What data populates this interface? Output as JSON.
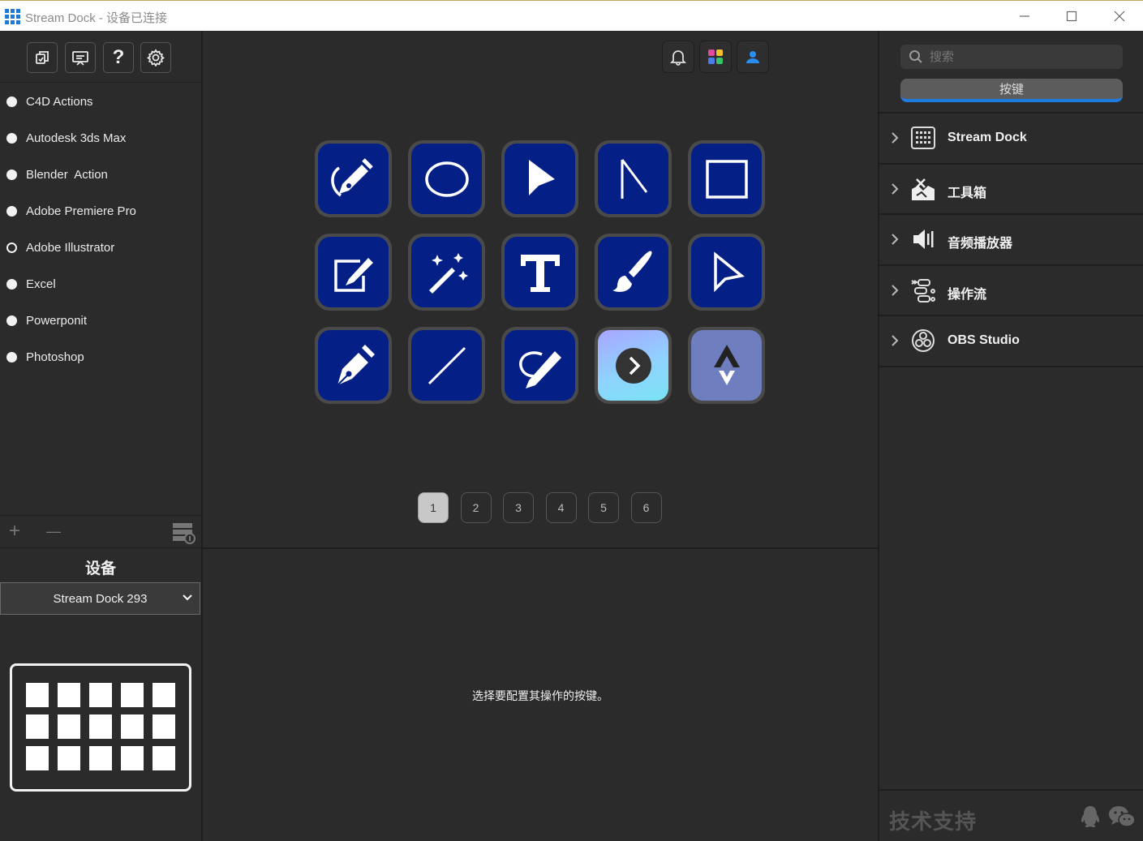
{
  "window": {
    "title": "Stream Dock - 设备已连接"
  },
  "left_toolbar": {
    "buttons": [
      "copy-icon",
      "presentation-icon",
      "help-icon",
      "settings-icon"
    ],
    "help_glyph": "?"
  },
  "profiles": [
    {
      "label": "C4D Actions",
      "selected": false
    },
    {
      "label": "Autodesk 3ds Max",
      "selected": false
    },
    {
      "label": "Blender  Action",
      "selected": false
    },
    {
      "label": "Adobe Premiere Pro",
      "selected": false
    },
    {
      "label": "Adobe Illustrator",
      "selected": true
    },
    {
      "label": "Excel",
      "selected": false
    },
    {
      "label": "Powerponit",
      "selected": false
    },
    {
      "label": "Photoshop",
      "selected": false
    }
  ],
  "profile_actions": {
    "add": "+",
    "remove": "—"
  },
  "device": {
    "heading": "设备",
    "selected": "Stream Dock 293"
  },
  "center": {
    "keys": [
      "pen-curve-icon",
      "ellipse-icon",
      "selection-arrow-icon",
      "direct-arrow-outline-icon",
      "rectangle-icon",
      "edit-image-icon",
      "magic-wand-icon",
      "text-tool-icon",
      "paintbrush-icon",
      "pointer-outline-icon",
      "pen-nib-icon",
      "line-tool-icon",
      "lasso-pen-icon",
      "next-page-icon",
      "folder-back-icon"
    ],
    "pages": [
      "1",
      "2",
      "3",
      "4",
      "5",
      "6"
    ],
    "active_page": "1",
    "hint": "选择要配置其操作的按键。"
  },
  "right": {
    "search_placeholder": "搜索",
    "tab_label": "按键",
    "categories": [
      {
        "label": "Stream Dock",
        "icon": "keypad-icon"
      },
      {
        "label": "工具箱",
        "icon": "toolbox-icon"
      },
      {
        "label": "音频播放器",
        "icon": "speaker-icon"
      },
      {
        "label": "操作流",
        "icon": "workflow-icon"
      },
      {
        "label": "OBS Studio",
        "icon": "obs-icon"
      }
    ],
    "support_label": "技术支持",
    "support_icons": [
      "qq-icon",
      "wechat-icon"
    ]
  },
  "colors": {
    "key_blue": "#041f86",
    "accent": "#1e7be0",
    "panel": "#2b2b2b"
  }
}
